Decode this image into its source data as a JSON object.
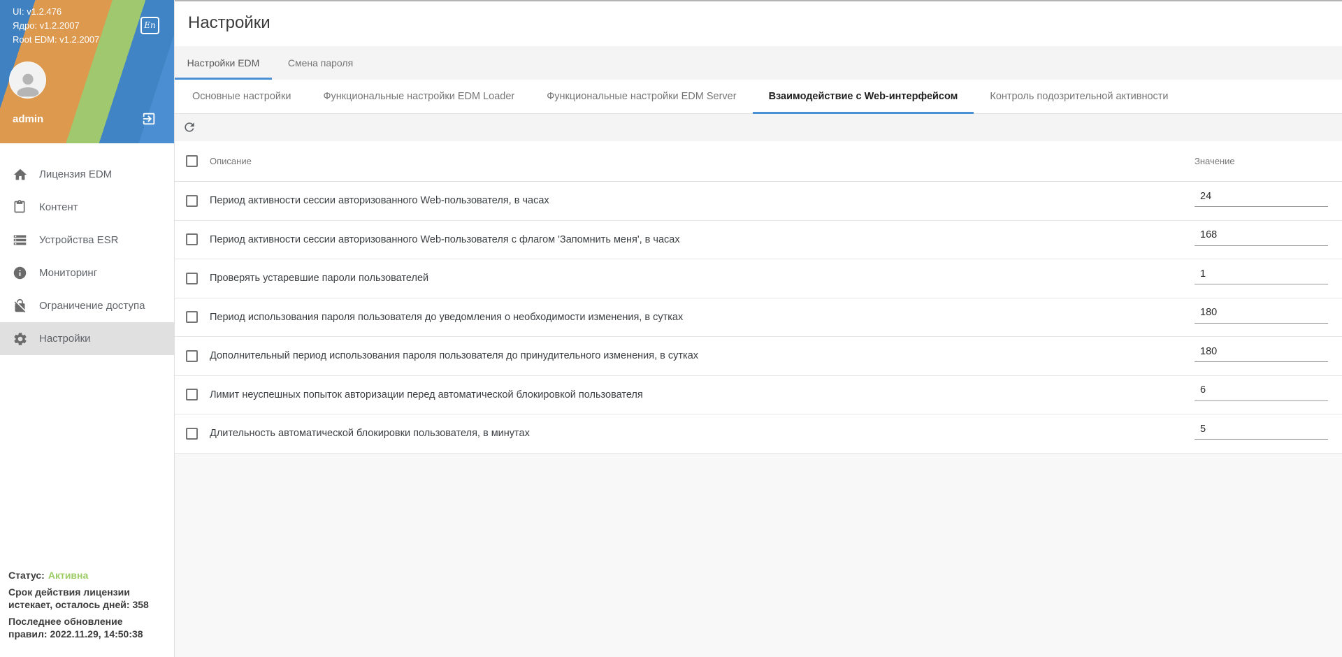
{
  "colors": {
    "accent_blue": "#4a90d5",
    "status_green": "#9ccc65",
    "selected_item_bg": "#e0e0e0",
    "header_stripes": [
      "#3f81c1",
      "#dd994e",
      "#a0c96f",
      "#4386c7"
    ]
  },
  "sidebar": {
    "versions": [
      "UI: v1.2.476",
      "Ядро: v1.2.2007",
      "Root EDM: v1.2.2007"
    ],
    "lang_badge": "En",
    "username": "admin",
    "menu": [
      {
        "label": "Лицензия EDM",
        "icon": "home-icon",
        "selected": false
      },
      {
        "label": "Контент",
        "icon": "clipboard-icon",
        "selected": false
      },
      {
        "label": "Устройства ESR",
        "icon": "storage-icon",
        "selected": false
      },
      {
        "label": "Мониторинг",
        "icon": "info-icon",
        "selected": false
      },
      {
        "label": "Ограничение доступа",
        "icon": "no-access-icon",
        "selected": false
      },
      {
        "label": "Настройки",
        "icon": "gear-icon",
        "selected": true
      }
    ],
    "status": {
      "label": "Статус:",
      "value": "Активна",
      "entries": [
        {
          "lines": [
            "Срок действия лицензии",
            "истекает, осталось дней: 358"
          ]
        },
        {
          "lines": [
            "Последнее обновление",
            "правил: 2022.11.29, 14:50:38"
          ]
        }
      ]
    }
  },
  "main": {
    "title": "Настройки",
    "tabs_primary": [
      {
        "label": "Настройки EDM",
        "active": true
      },
      {
        "label": "Смена пароля",
        "active": false
      }
    ],
    "tabs_secondary": [
      {
        "label": "Основные настройки",
        "active": false
      },
      {
        "label": "Функциональные настройки EDM Loader",
        "active": false
      },
      {
        "label": "Функциональные настройки EDM Server",
        "active": false
      },
      {
        "label": "Взаимодействие с Web-интерфейсом",
        "active": true
      },
      {
        "label": "Контроль подозрительной активности",
        "active": false
      }
    ],
    "table": {
      "columns": [
        "Описание",
        "Значение"
      ],
      "rows": [
        {
          "description": "Период активности сессии авторизованного Web-пользователя, в часах",
          "value": "24"
        },
        {
          "description": "Период активности сессии авторизованного Web-пользователя с флагом 'Запомнить меня', в часах",
          "value": "168"
        },
        {
          "description": "Проверять устаревшие пароли пользователей",
          "value": "1"
        },
        {
          "description": "Период использования пароля пользователя до уведомления о необходимости изменения, в сутках",
          "value": "180"
        },
        {
          "description": "Дополнительный период использования пароля пользователя до принудительного изменения, в сутках",
          "value": "180"
        },
        {
          "description": "Лимит неуспешных попыток авторизации перед автоматической блокировкой пользователя",
          "value": "6"
        },
        {
          "description": "Длительность автоматической блокировки пользователя, в минутах",
          "value": "5"
        }
      ]
    }
  }
}
